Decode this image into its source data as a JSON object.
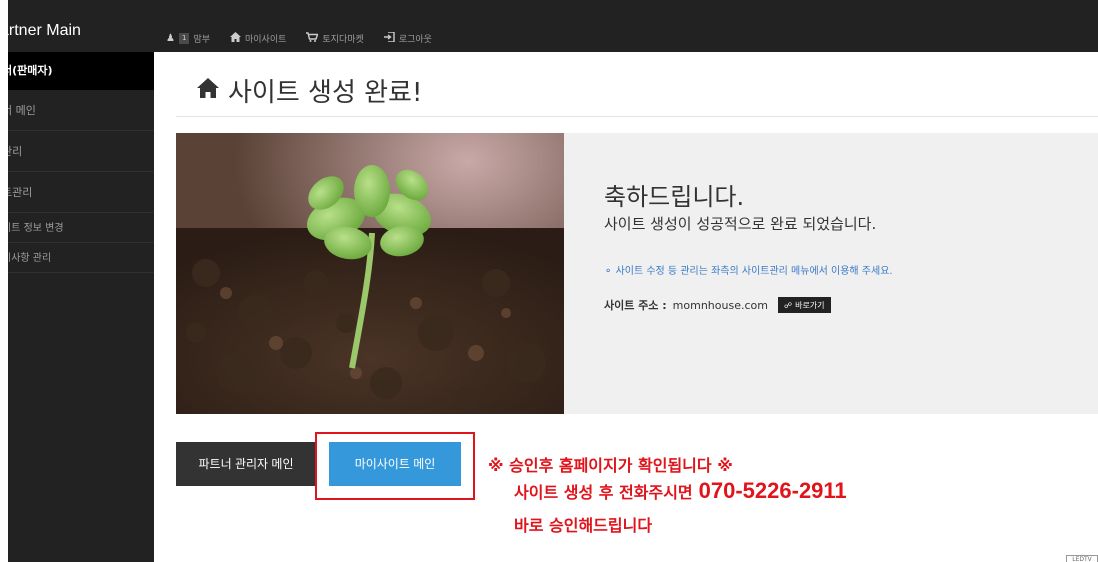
{
  "brand": "artner Main",
  "sidebar": {
    "header": "너(판매자)",
    "items": [
      {
        "label": "너 메인"
      },
      {
        "label": "관리"
      },
      {
        "label": "트관리"
      },
      {
        "label": "이트 정보 변경"
      },
      {
        "label": "지사항 관리"
      }
    ]
  },
  "topbar": {
    "user_badge": "1",
    "user_name": "맘부",
    "links": [
      {
        "icon": "home-icon",
        "label": "마이사이트"
      },
      {
        "icon": "cart-icon",
        "label": "토지다마켓"
      },
      {
        "icon": "logout-icon",
        "label": "로그아웃"
      }
    ]
  },
  "page": {
    "title": "사이트 생성 완료!"
  },
  "panel": {
    "congrats": "축하드립니다.",
    "complete": "사이트 생성이 성공적으로 완료 되었습니다.",
    "note": "사이트 수정 등 관리는 좌측의 사이트관리 메뉴에서 이용해 주세요.",
    "site_label": "사이트 주소 :",
    "site_address": "momnhouse.com",
    "goto_label": "바로가기"
  },
  "buttons": {
    "partner_main": "파트너 관리자 메인",
    "mysite_main": "마이사이트 메인"
  },
  "notice": {
    "line1": "※ 승인후 홈페이지가 확인됩니다 ※",
    "line2": "사이트 생성 후 전화주시면",
    "phone": "070-5226-2911",
    "line3": "바로 승인해드립니다"
  },
  "corner_tag": "LEDTV",
  "colors": {
    "dark": "#222222",
    "accent_blue": "#3498db",
    "notice_red": "#e0141b",
    "link_blue": "#3a7ac8"
  }
}
